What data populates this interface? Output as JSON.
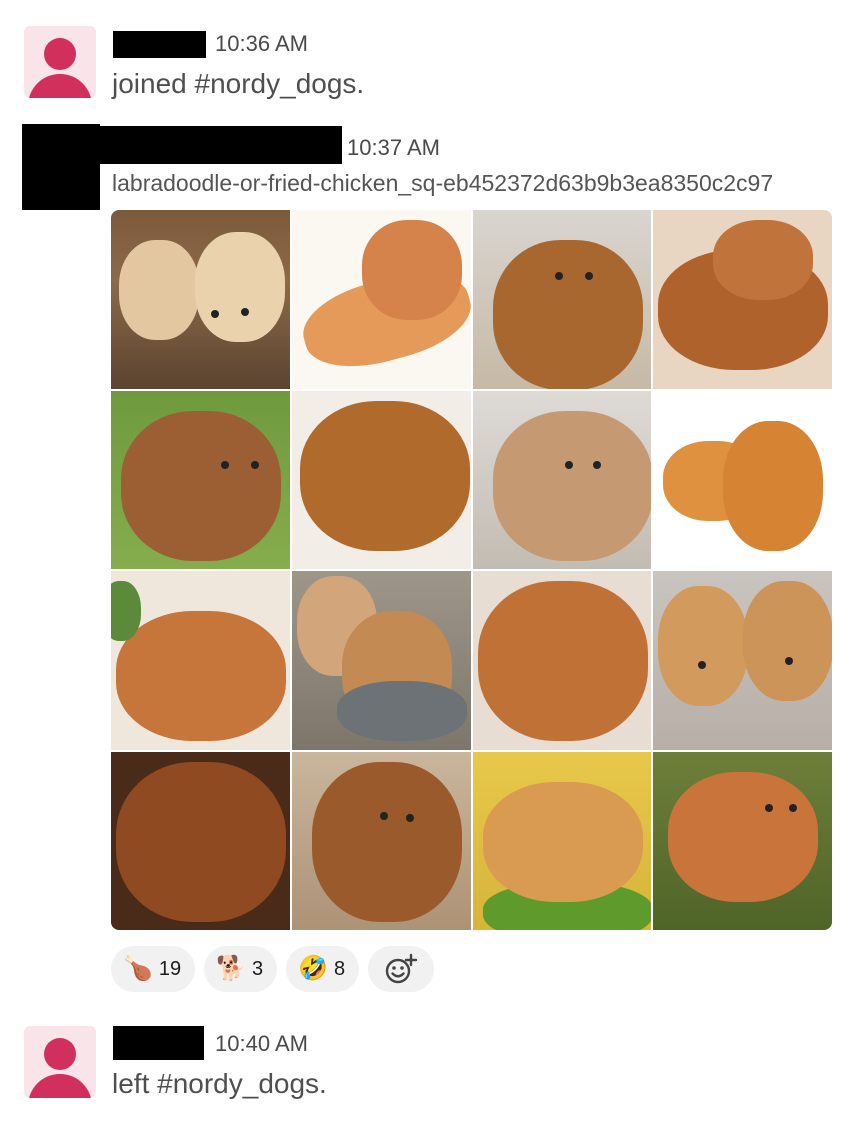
{
  "messages": [
    {
      "time": "10:36 AM",
      "text": "joined #nordy_dogs."
    },
    {
      "time": "10:37 AM",
      "filename": "labradoodle-or-fried-chicken_sq-eb452372d63b9b3ea8350c2c97"
    },
    {
      "time": "10:40 AM",
      "text": "left #nordy_dogs."
    }
  ],
  "image_tiles": [
    "labradoodle-puppies",
    "fried-chicken-drumstick",
    "labradoodle",
    "fried-chicken-basket",
    "labradoodle-on-grass",
    "fried-chicken-bucket",
    "labradoodle-lying",
    "fried-chicken-drumsticks",
    "fried-chicken-plate",
    "labradoodle-puppies-bowl",
    "fried-chicken-pile",
    "labradoodle-puppies-held",
    "fried-chicken-closeup",
    "labradoodle-curly",
    "fried-chicken-lettuce",
    "labradoodle-on-moss"
  ],
  "reactions": [
    {
      "icon": "drumstick-icon",
      "glyph": "🍗",
      "count": "19"
    },
    {
      "icon": "dog-icon",
      "glyph": "🐕",
      "count": "3"
    },
    {
      "icon": "rofl-icon",
      "glyph": "🤣",
      "count": "8"
    }
  ],
  "add_reaction_icon": "add-reaction-icon",
  "colors": {
    "avatar_bg": "#f8e4e9",
    "avatar_fg": "#d12f5c",
    "pill_bg": "#f1f1f1"
  }
}
